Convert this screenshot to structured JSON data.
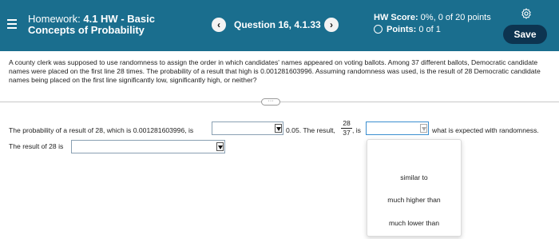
{
  "header": {
    "title_prefix": "Homework: ",
    "title_bold": "4.1 HW - Basic",
    "title_line2": "Concepts of Probability",
    "prev_label": "‹",
    "next_label": "›",
    "question_label": "Question 16, 4.1.33",
    "score_label": "HW Score:",
    "score_value": " 0%, 0 of 20 points",
    "points_label": "Points:",
    "points_value": " 0 of 1",
    "save_label": "Save",
    "bg_color": "#1a6e8e",
    "save_color": "#0d3450"
  },
  "question": {
    "text": "A county clerk was supposed to use randomness to assign the order in which candidates' names appeared on voting ballots. Among 37 different ballots, Democratic candidate names were placed on the first line 28 times. The probability of a result that high is 0.001281603996. Assuming randomness was used, is the result of 28 Democratic candidate names being placed on the first line significantly low, significantly high, or neither?"
  },
  "answer": {
    "sentence1_part1": "The probability of a result of 28, which is 0.001281603996, is",
    "sentence1_part2": "0.05. The result,",
    "fraction_num": "28",
    "fraction_den": "37",
    "sentence1_part3": ", is",
    "sentence1_part4": "what is expected with randomness.",
    "sentence2": "The result of 28 is"
  },
  "dropdown_options": [
    "similar to",
    "much higher than",
    "much lower than"
  ],
  "icons": {
    "menu": "menu-icon",
    "settings": "gear-icon",
    "points": "circle-icon"
  }
}
